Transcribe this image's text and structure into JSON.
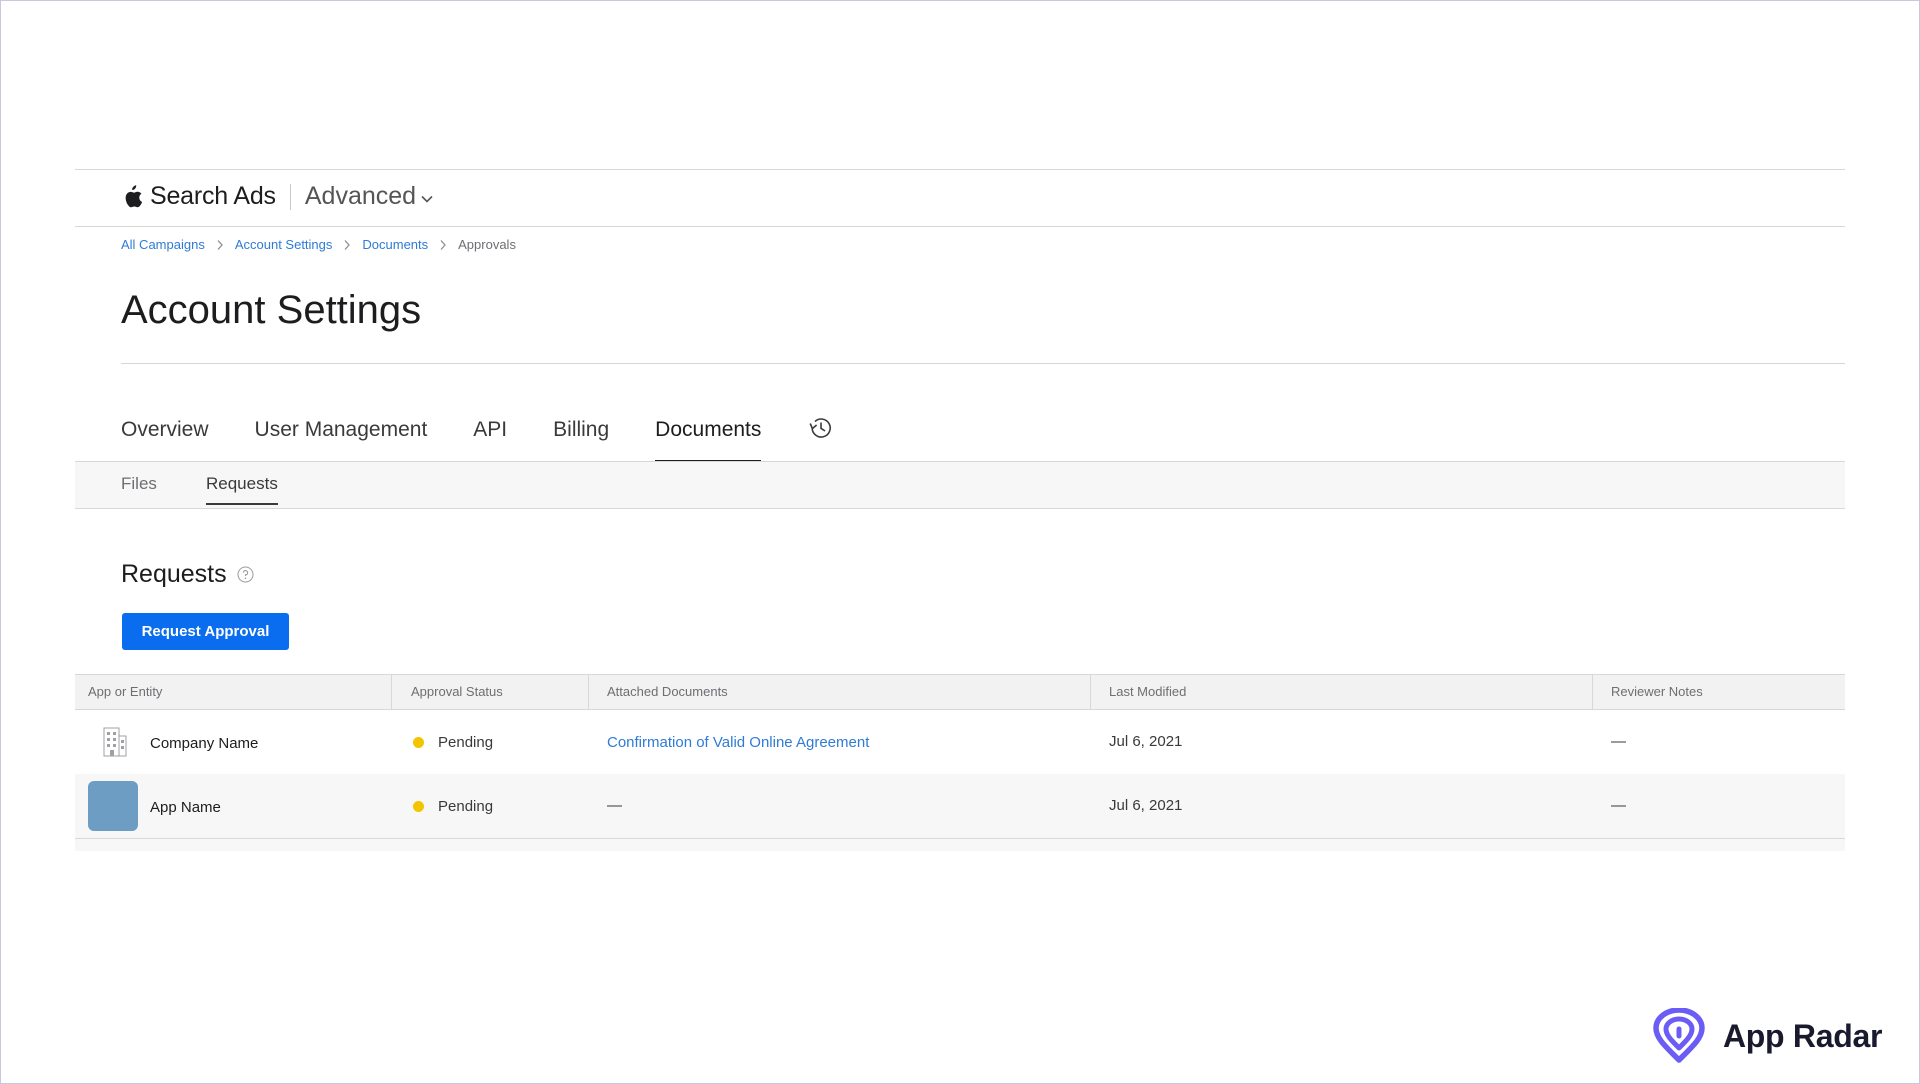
{
  "header": {
    "brand": "Search Ads",
    "product": "Advanced",
    "icons": {
      "logo": "apple-icon",
      "product_menu": "chevron-down-icon"
    }
  },
  "breadcrumb": {
    "items": [
      "All Campaigns",
      "Account Settings",
      "Documents"
    ],
    "current": "Approvals"
  },
  "page": {
    "title": "Account Settings"
  },
  "tabs": {
    "items": [
      "Overview",
      "User Management",
      "API",
      "Billing",
      "Documents"
    ],
    "active": "Documents",
    "history_icon": "history-icon"
  },
  "subtabs": {
    "items": [
      "Files",
      "Requests"
    ],
    "active": "Requests"
  },
  "section": {
    "title": "Requests",
    "help_icon": "help-icon",
    "button_label": "Request Approval"
  },
  "table": {
    "columns": [
      "App or Entity",
      "Approval Status",
      "Attached Documents",
      "Last Modified",
      "Reviewer Notes"
    ],
    "rows": [
      {
        "entity": "Company Name",
        "icon": "building-icon",
        "status": "Pending",
        "document": "Confirmation of Valid Online Agreement",
        "modified": "Jul 6, 2021",
        "notes": "—"
      },
      {
        "entity": "App Name",
        "icon": "app-thumbnail",
        "status": "Pending",
        "document": "—",
        "modified": "Jul 6, 2021",
        "notes": "—"
      }
    ],
    "status_color": "#f5c400"
  },
  "watermark": {
    "text": "App Radar",
    "icon": "radar-icon",
    "color": "#6b5cf6"
  },
  "colors": {
    "primary": "#0a6df0",
    "link": "#2f7bd6"
  }
}
